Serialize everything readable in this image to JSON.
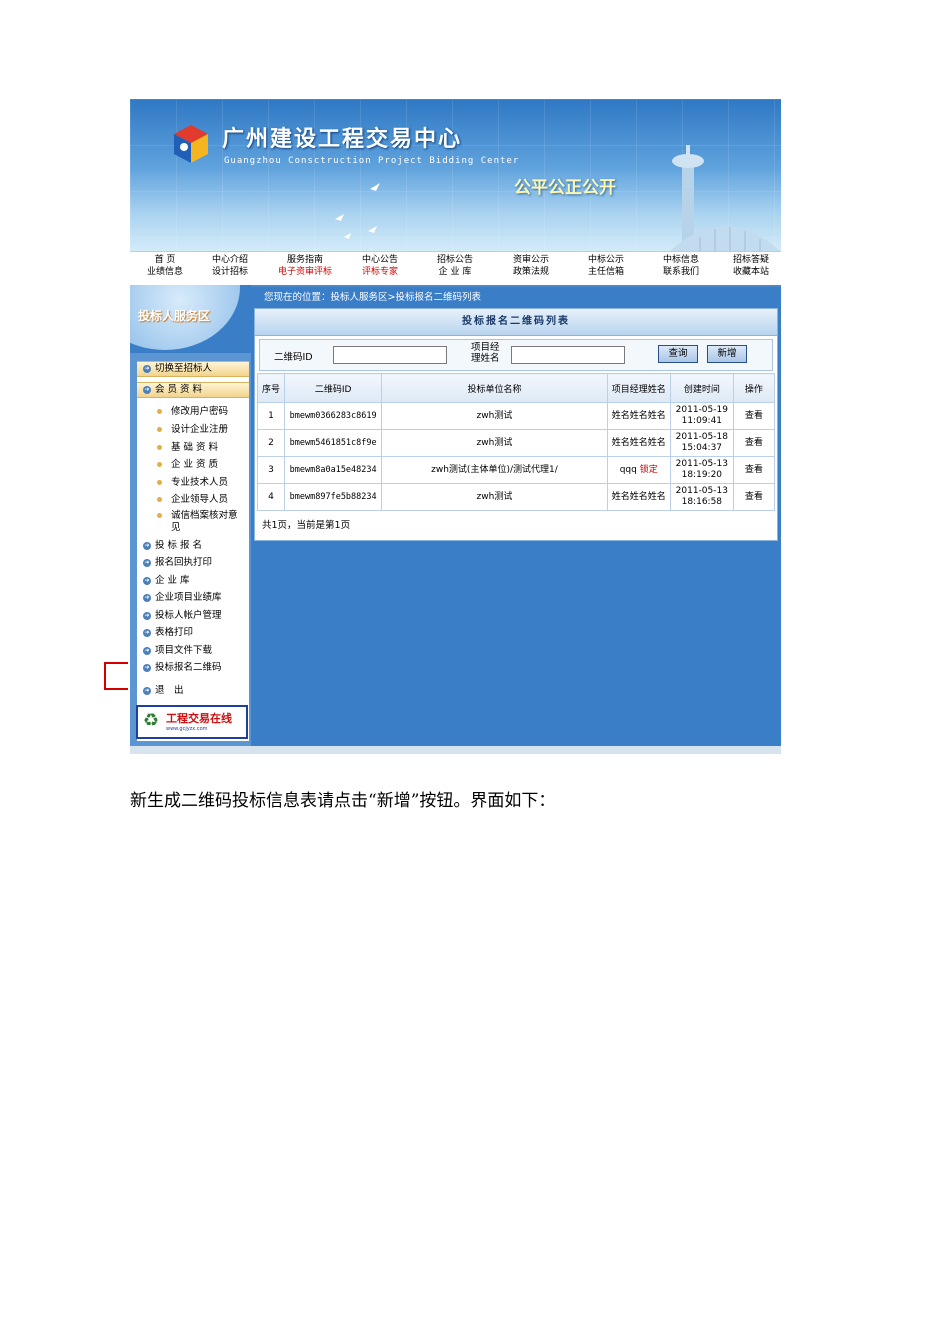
{
  "header": {
    "title": "广州建设工程交易中心",
    "subtitle": "Guangzhou Consctruction Project Bidding Center",
    "slogan": "公平公正公开"
  },
  "nav": [
    {
      "top": "首 页",
      "bottom": "业绩信息",
      "bottom_red": false
    },
    {
      "top": "中心介绍",
      "bottom": "设计招标",
      "bottom_red": false
    },
    {
      "top": "服务指南",
      "bottom": "电子资审评标",
      "bottom_red": true
    },
    {
      "top": "中心公告",
      "bottom": "评标专家",
      "bottom_red": true
    },
    {
      "top": "招标公告",
      "bottom": "企 业 库",
      "bottom_red": false
    },
    {
      "top": "资审公示",
      "bottom": "政策法规",
      "bottom_red": false
    },
    {
      "top": "中标公示",
      "bottom": "主任信箱",
      "bottom_red": false
    },
    {
      "top": "中标信息",
      "bottom": "联系我们",
      "bottom_red": false
    },
    {
      "top": "招标答疑",
      "bottom": "收藏本站",
      "bottom_red": false
    }
  ],
  "breadcrumb": "您现在的位置：投标人服务区>投标报名二维码列表",
  "sidebar": {
    "title": "投标人服务区",
    "switch": "切换至招标人",
    "member": "会 员 资 料",
    "sub_items": [
      "修改用户密码",
      "设计企业注册",
      "基 础 资 料",
      "企 业 资 质",
      "专业技术人员",
      "企业领导人员",
      "诚信档案核对意见"
    ],
    "items": [
      "投 标 报 名",
      "报名回执打印",
      "企 业 库",
      "企业项目业绩库",
      "投标人帐户管理",
      "表格打印",
      "项目文件下载",
      "投标报名二维码"
    ],
    "logout": "退　出",
    "logo_text": "工程交易在线",
    "logo_url": "www.gcjyzx.com"
  },
  "panel": {
    "title": "投标报名二维码列表",
    "search": {
      "qr_label": "二维码ID",
      "pm_label_1": "项目经",
      "pm_label_2": "理姓名",
      "query_btn": "查询",
      "add_btn": "新增"
    },
    "columns": [
      "序号",
      "二维码ID",
      "投标单位名称",
      "项目经理姓名",
      "创建时间",
      "操作"
    ],
    "rows": [
      {
        "no": "1",
        "qr": "bmewm0366283c8619",
        "unit": "zwh测试",
        "pm": "姓名姓名姓名",
        "pm_lock": "",
        "date": "2011-05-19",
        "time": "11:09:41",
        "op": "查看"
      },
      {
        "no": "2",
        "qr": "bmewm5461851c8f9e",
        "unit": "zwh测试",
        "pm": "姓名姓名姓名",
        "pm_lock": "",
        "date": "2011-05-18",
        "time": "15:04:37",
        "op": "查看"
      },
      {
        "no": "3",
        "qr": "bmewm8a0a15e48234",
        "unit": "zwh测试(主体单位)/测试代理1/",
        "pm": "qqq",
        "pm_lock": "锁定",
        "date": "2011-05-13",
        "time": "18:19:20",
        "op": "查看"
      },
      {
        "no": "4",
        "qr": "bmewm897fe5b88234",
        "unit": "zwh测试",
        "pm": "姓名姓名姓名",
        "pm_lock": "",
        "date": "2011-05-13",
        "time": "18:16:58",
        "op": "查看"
      }
    ],
    "pager": "共1页，当前是第1页"
  },
  "caption": "新生成二维码投标信息表请点击“新增”按钮。界面如下：",
  "colors": {
    "primary_blue": "#3b7ec8",
    "link_red": "#d40000",
    "marker_red": "#d40000"
  }
}
